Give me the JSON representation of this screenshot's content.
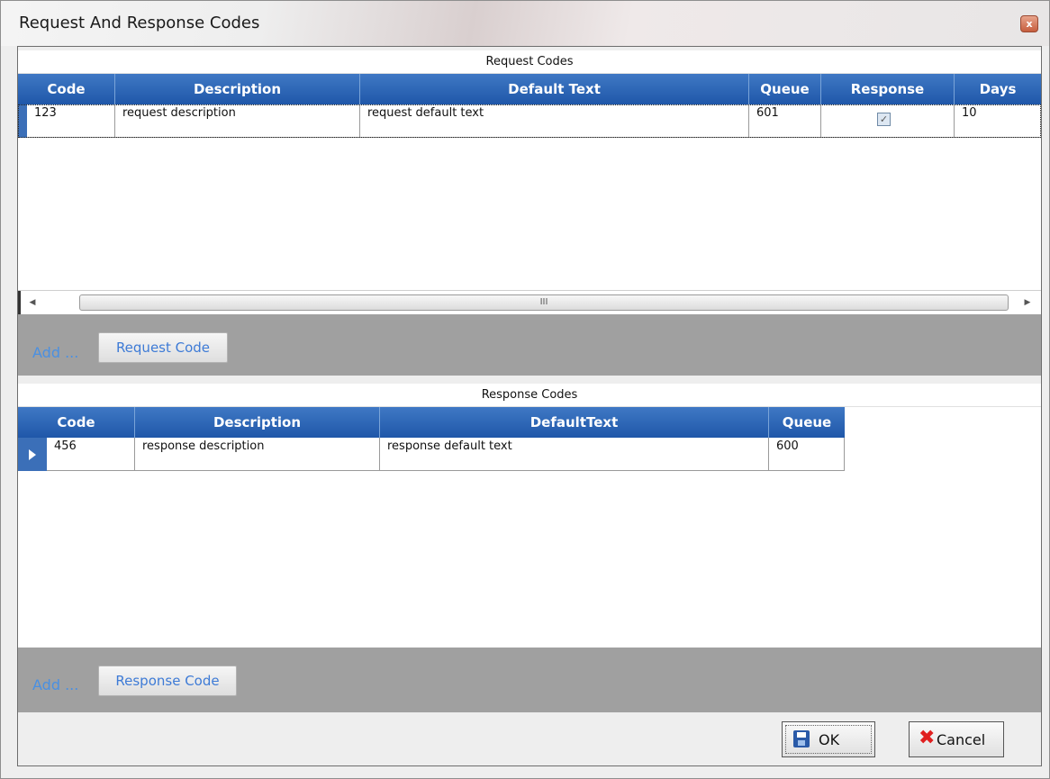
{
  "window": {
    "title": "Request And Response Codes",
    "close_glyph": "x"
  },
  "request": {
    "section_title": "Request Codes",
    "columns": [
      "Code",
      "Description",
      "Default Text",
      "Queue",
      "Response",
      "Days"
    ],
    "rows": [
      {
        "code": "123",
        "description": "request description",
        "default_text": "request default text",
        "queue": "601",
        "response": true,
        "days": "10"
      }
    ],
    "scroll_thumb_glyph": "III",
    "add_label": "Add ...",
    "button_label": "Request Code"
  },
  "response": {
    "section_title": "Response Codes",
    "columns": [
      "Code",
      "Description",
      "DefaultText",
      "Queue"
    ],
    "rows": [
      {
        "code": "456",
        "description": "response description",
        "default_text": "response default text",
        "queue": "600"
      }
    ],
    "add_label": "Add ...",
    "button_label": "Response Code"
  },
  "footer": {
    "ok_label": "OK",
    "cancel_label": "Cancel"
  },
  "colors": {
    "header_blue": "#1f57a9",
    "link_blue": "#4a90e2",
    "band_gray": "#a0a0a0"
  },
  "icons": {
    "close": "close-icon",
    "save": "save-icon",
    "cancel": "cancel-x-icon",
    "check": "checkmark-icon",
    "row_selector": "row-selector-arrow-icon"
  }
}
